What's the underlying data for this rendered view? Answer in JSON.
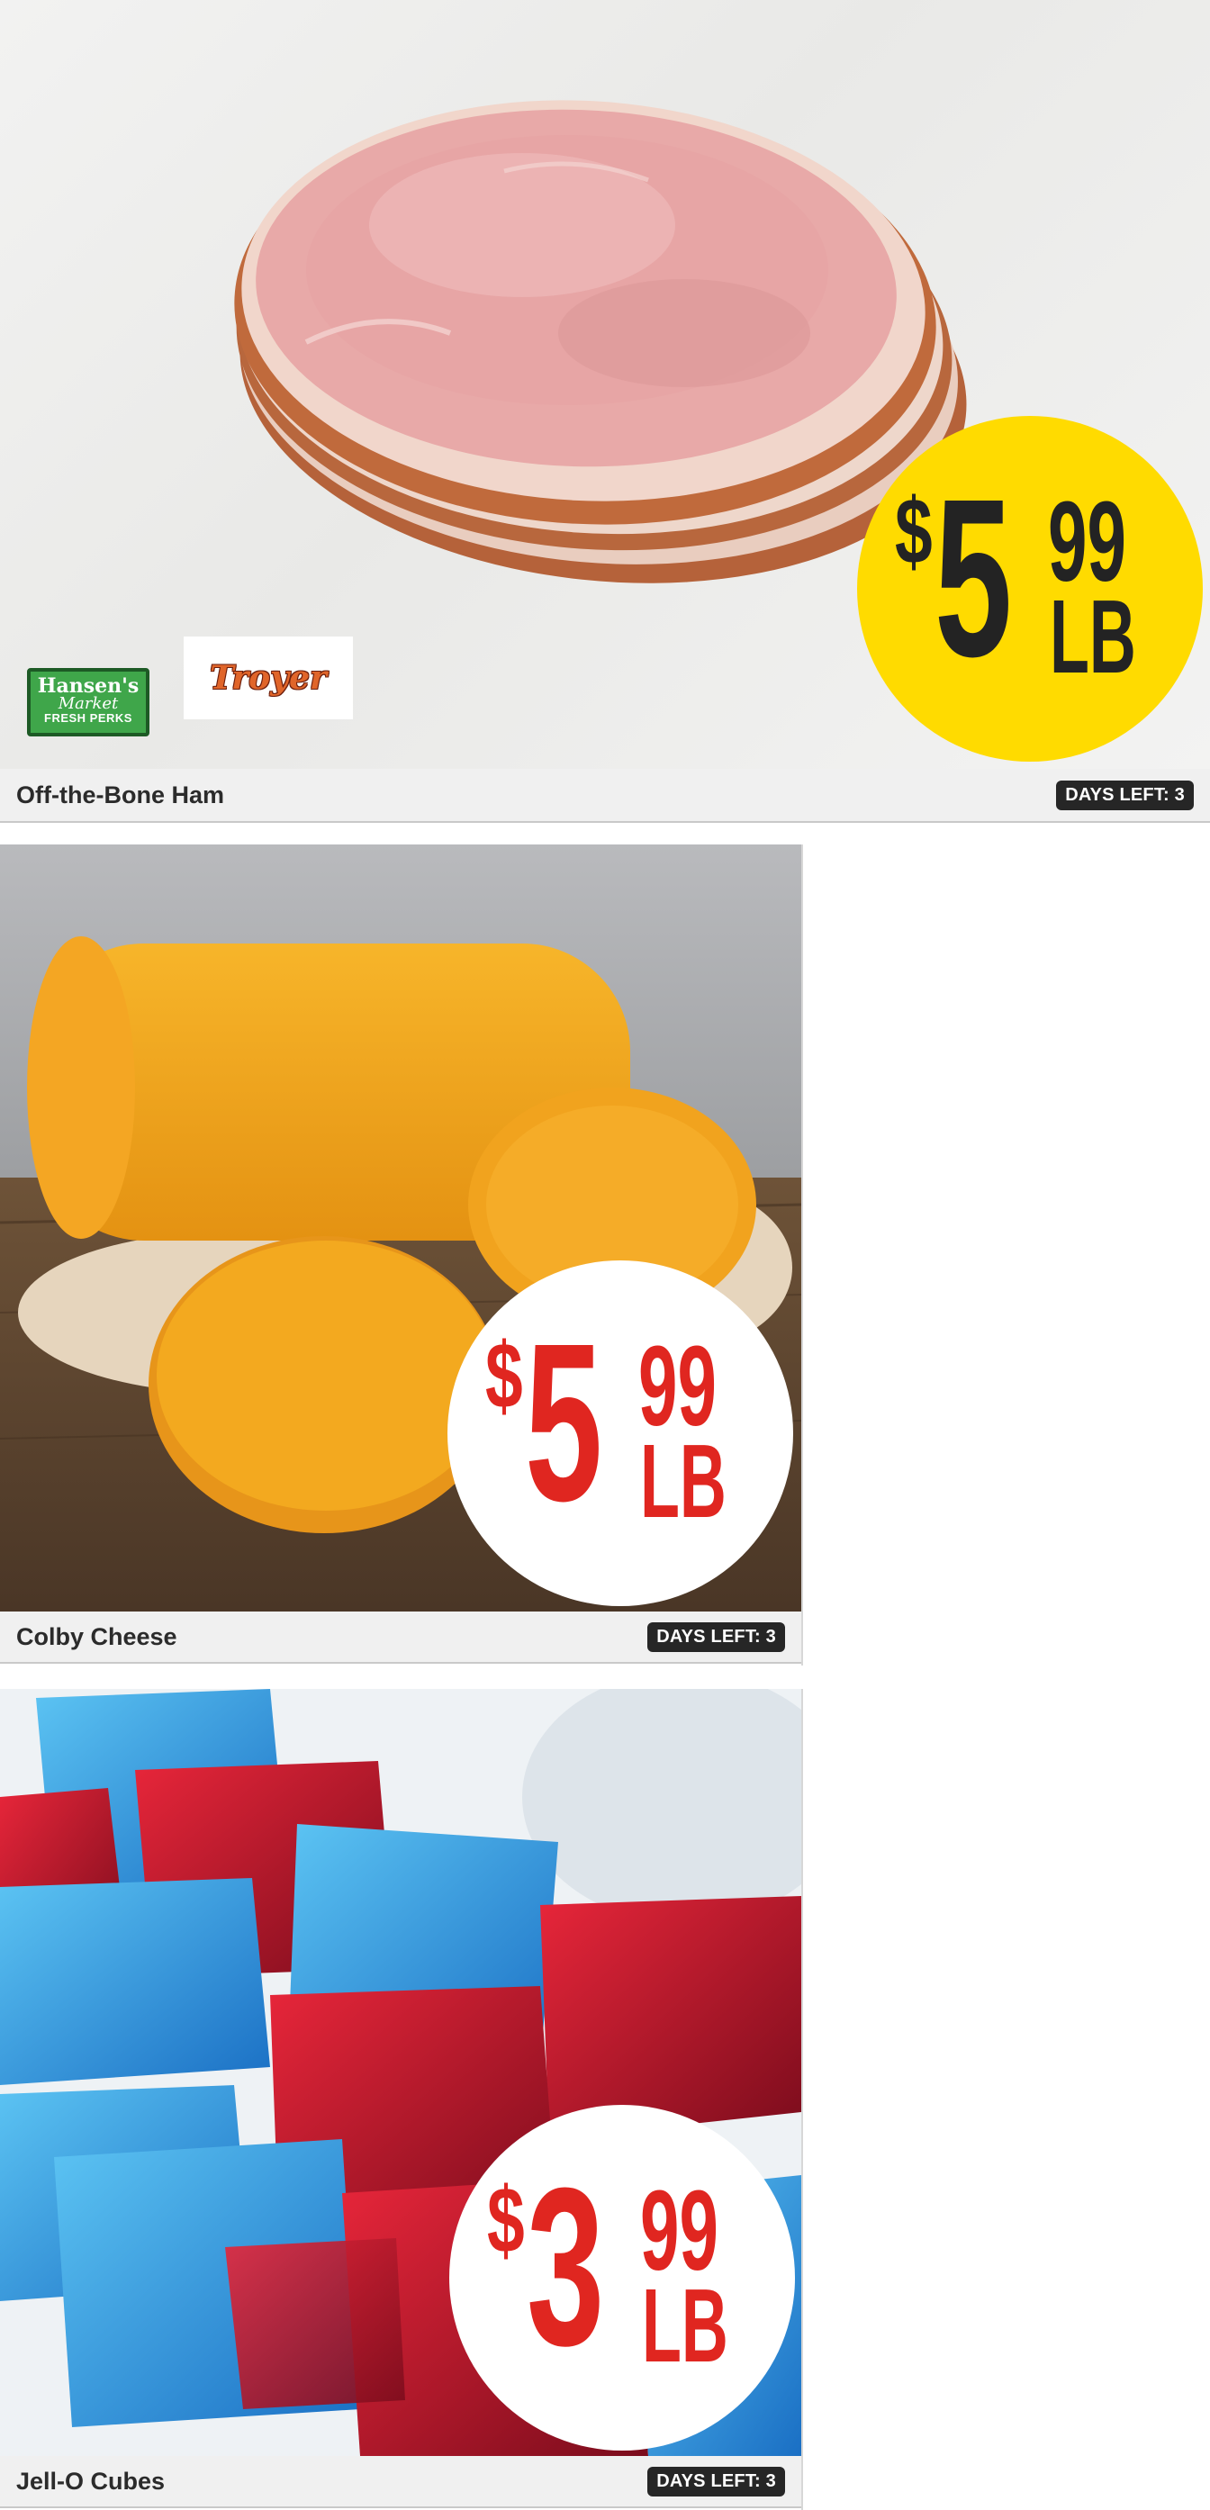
{
  "deals": [
    {
      "name": "Off-the-Bone Ham",
      "price": {
        "currency": "$",
        "whole": "5",
        "cents": "99",
        "unit": "LB"
      },
      "days_left_label": "DAYS LEFT: 3",
      "badge_color": "#ffdb00",
      "price_text_color": "#232323",
      "brand_logos": [
        {
          "name": "hansens-market-logo",
          "text": [
            "Hansen's",
            "Market",
            "FRESH PERKS"
          ]
        },
        {
          "name": "troyer-logo",
          "text": "Troyer"
        }
      ]
    },
    {
      "name": "Colby Cheese",
      "price": {
        "currency": "$",
        "whole": "5",
        "cents": "99",
        "unit": "LB"
      },
      "days_left_label": "DAYS LEFT: 3",
      "badge_color": "#ffffff",
      "price_text_color": "#e02620"
    },
    {
      "name": "Jell-O Cubes",
      "price": {
        "currency": "$",
        "whole": "3",
        "cents": "99",
        "unit": "LB"
      },
      "days_left_label": "DAYS LEFT: 3",
      "badge_color": "#ffffff",
      "price_text_color": "#e02620"
    }
  ]
}
